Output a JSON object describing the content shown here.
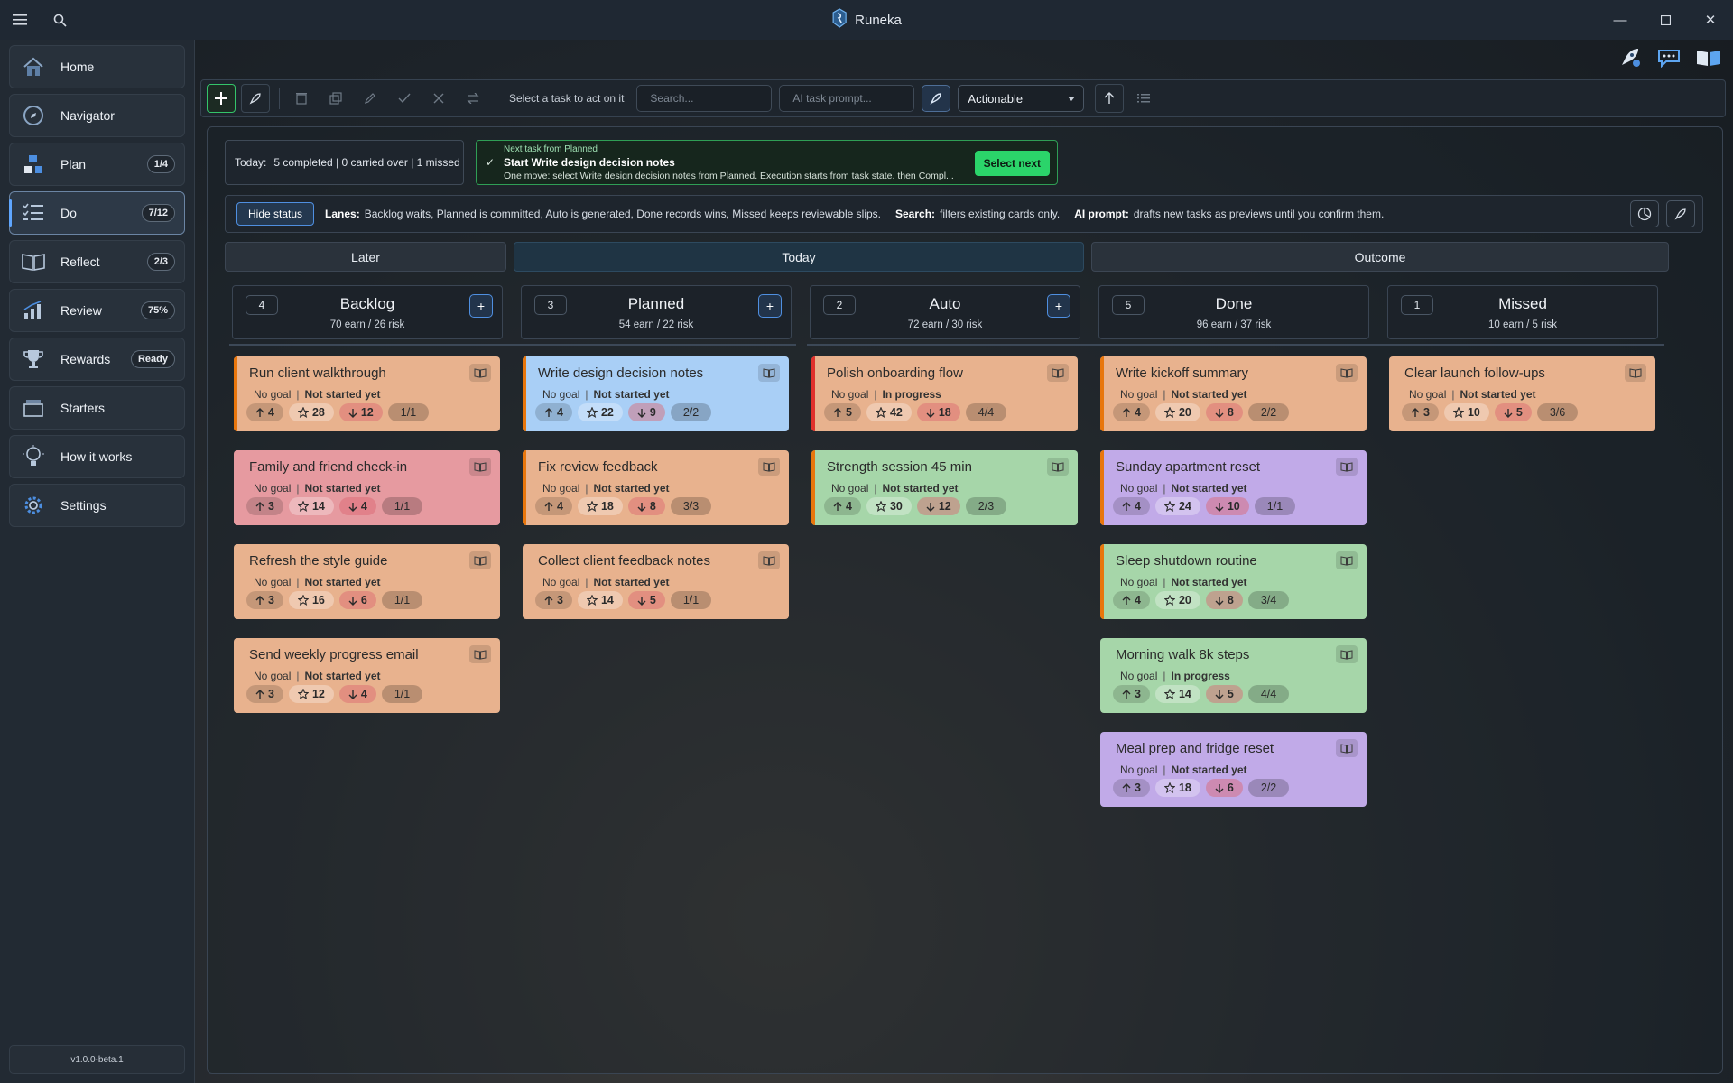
{
  "app": {
    "title": "Runeka",
    "version": "v1.0.0-beta.1"
  },
  "sidebar": {
    "items": [
      {
        "label": "Home",
        "badge": ""
      },
      {
        "label": "Navigator",
        "badge": ""
      },
      {
        "label": "Plan",
        "badge": "1/4"
      },
      {
        "label": "Do",
        "badge": "7/12"
      },
      {
        "label": "Reflect",
        "badge": "2/3"
      },
      {
        "label": "Review",
        "badge": "75%"
      },
      {
        "label": "Rewards",
        "badge": "Ready"
      },
      {
        "label": "Starters",
        "badge": ""
      },
      {
        "label": "How it works",
        "badge": ""
      },
      {
        "label": "Settings",
        "badge": ""
      }
    ]
  },
  "toolbar": {
    "hint": "Select a task to act on it",
    "search_placeholder": "Search...",
    "ai_placeholder": "AI task prompt...",
    "filter_value": "Actionable"
  },
  "summary": {
    "today_label": "Today:",
    "today_text": "5 completed | 0 carried over | 1 missed"
  },
  "next_task": {
    "line1": "Next task from Planned",
    "line2": "Start Write design decision notes",
    "line3": "One move: select Write design decision notes from Planned. Execution starts from task state. then Compl...",
    "button": "Select next"
  },
  "status_bar": {
    "hide_label": "Hide status",
    "lanes_label": "Lanes:",
    "lanes_text": "Backlog waits, Planned is committed, Auto is generated, Done records wins, Missed keeps reviewable slips.",
    "search_label": "Search:",
    "search_text": "filters existing cards only.",
    "ai_label": "AI prompt:",
    "ai_text": "drafts new tasks as previews until you confirm them."
  },
  "groups": {
    "later": "Later",
    "today": "Today",
    "outcome": "Outcome"
  },
  "lanes": [
    {
      "count": "4",
      "title": "Backlog",
      "sub": "70 earn / 26 risk",
      "add": "+"
    },
    {
      "count": "3",
      "title": "Planned",
      "sub": "54 earn / 22 risk",
      "add": "+"
    },
    {
      "count": "2",
      "title": "Auto",
      "sub": "72 earn / 30 risk",
      "add": "+"
    },
    {
      "count": "5",
      "title": "Done",
      "sub": "96 earn / 37 risk",
      "add": ""
    },
    {
      "count": "1",
      "title": "Missed",
      "sub": "10 earn / 5 risk",
      "add": ""
    }
  ],
  "cards": {
    "backlog": [
      {
        "title": "Run client walkthrough",
        "goal": "No goal",
        "state": "Not started yet",
        "up": "4",
        "star": "28",
        "down": "12",
        "frac": "1/1"
      },
      {
        "title": "Family and friend check-in",
        "goal": "No goal",
        "state": "Not started yet",
        "up": "3",
        "star": "14",
        "down": "4",
        "frac": "1/1"
      },
      {
        "title": "Refresh the style guide",
        "goal": "No goal",
        "state": "Not started yet",
        "up": "3",
        "star": "16",
        "down": "6",
        "frac": "1/1"
      },
      {
        "title": "Send weekly progress email",
        "goal": "No goal",
        "state": "Not started yet",
        "up": "3",
        "star": "12",
        "down": "4",
        "frac": "1/1"
      }
    ],
    "planned": [
      {
        "title": "Write design decision notes",
        "goal": "No goal",
        "state": "Not started yet",
        "up": "4",
        "star": "22",
        "down": "9",
        "frac": "2/2"
      },
      {
        "title": "Fix review feedback",
        "goal": "No goal",
        "state": "Not started yet",
        "up": "4",
        "star": "18",
        "down": "8",
        "frac": "3/3"
      },
      {
        "title": "Collect client feedback notes",
        "goal": "No goal",
        "state": "Not started yet",
        "up": "3",
        "star": "14",
        "down": "5",
        "frac": "1/1"
      }
    ],
    "auto": [
      {
        "title": "Polish onboarding flow",
        "goal": "No goal",
        "state": "In progress",
        "up": "5",
        "star": "42",
        "down": "18",
        "frac": "4/4"
      },
      {
        "title": "Strength session 45 min",
        "goal": "No goal",
        "state": "Not started yet",
        "up": "4",
        "star": "30",
        "down": "12",
        "frac": "2/3"
      }
    ],
    "done": [
      {
        "title": "Write kickoff summary",
        "goal": "No goal",
        "state": "Not started yet",
        "up": "4",
        "star": "20",
        "down": "8",
        "frac": "2/2"
      },
      {
        "title": "Sunday apartment reset",
        "goal": "No goal",
        "state": "Not started yet",
        "up": "4",
        "star": "24",
        "down": "10",
        "frac": "1/1"
      },
      {
        "title": "Sleep shutdown routine",
        "goal": "No goal",
        "state": "Not started yet",
        "up": "4",
        "star": "20",
        "down": "8",
        "frac": "3/4"
      },
      {
        "title": "Morning walk 8k steps",
        "goal": "No goal",
        "state": "In progress",
        "up": "3",
        "star": "14",
        "down": "5",
        "frac": "4/4"
      },
      {
        "title": "Meal prep and fridge reset",
        "goal": "No goal",
        "state": "Not started yet",
        "up": "3",
        "star": "18",
        "down": "6",
        "frac": "2/2"
      }
    ],
    "missed": [
      {
        "title": "Clear launch follow-ups",
        "goal": "No goal",
        "state": "Not started yet",
        "up": "3",
        "star": "10",
        "down": "5",
        "frac": "3/6"
      }
    ]
  },
  "colors": {
    "accent_green": "#2bd46a",
    "accent_blue": "#4f8fe0",
    "card_orange": "#e8b28e",
    "card_pink": "#e69aa0",
    "card_blue": "#a9cff6",
    "card_green": "#a6d6a9",
    "card_purple": "#c1aae8"
  }
}
